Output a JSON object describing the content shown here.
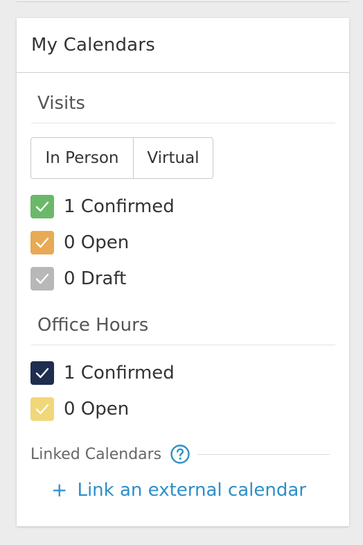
{
  "panel": {
    "title": "My Calendars"
  },
  "visits": {
    "heading": "Visits",
    "segments": [
      "In Person",
      "Virtual"
    ],
    "items": [
      {
        "label": "1 Confirmed",
        "color": "#6cb86a",
        "checked": true
      },
      {
        "label": "0 Open",
        "color": "#e8aa55",
        "checked": true
      },
      {
        "label": "0 Draft",
        "color": "#b8b8b8",
        "checked": true
      }
    ]
  },
  "office_hours": {
    "heading": "Office Hours",
    "items": [
      {
        "label": "1 Confirmed",
        "color": "#1f2d4e",
        "checked": true
      },
      {
        "label": "0 Open",
        "color": "#f0d77a",
        "checked": true
      }
    ]
  },
  "linked": {
    "label": "Linked Calendars",
    "help_icon": "question-circle-icon",
    "link_text": "Link an external calendar",
    "link_icon": "plus-icon",
    "link_color": "#2d8fc9"
  }
}
